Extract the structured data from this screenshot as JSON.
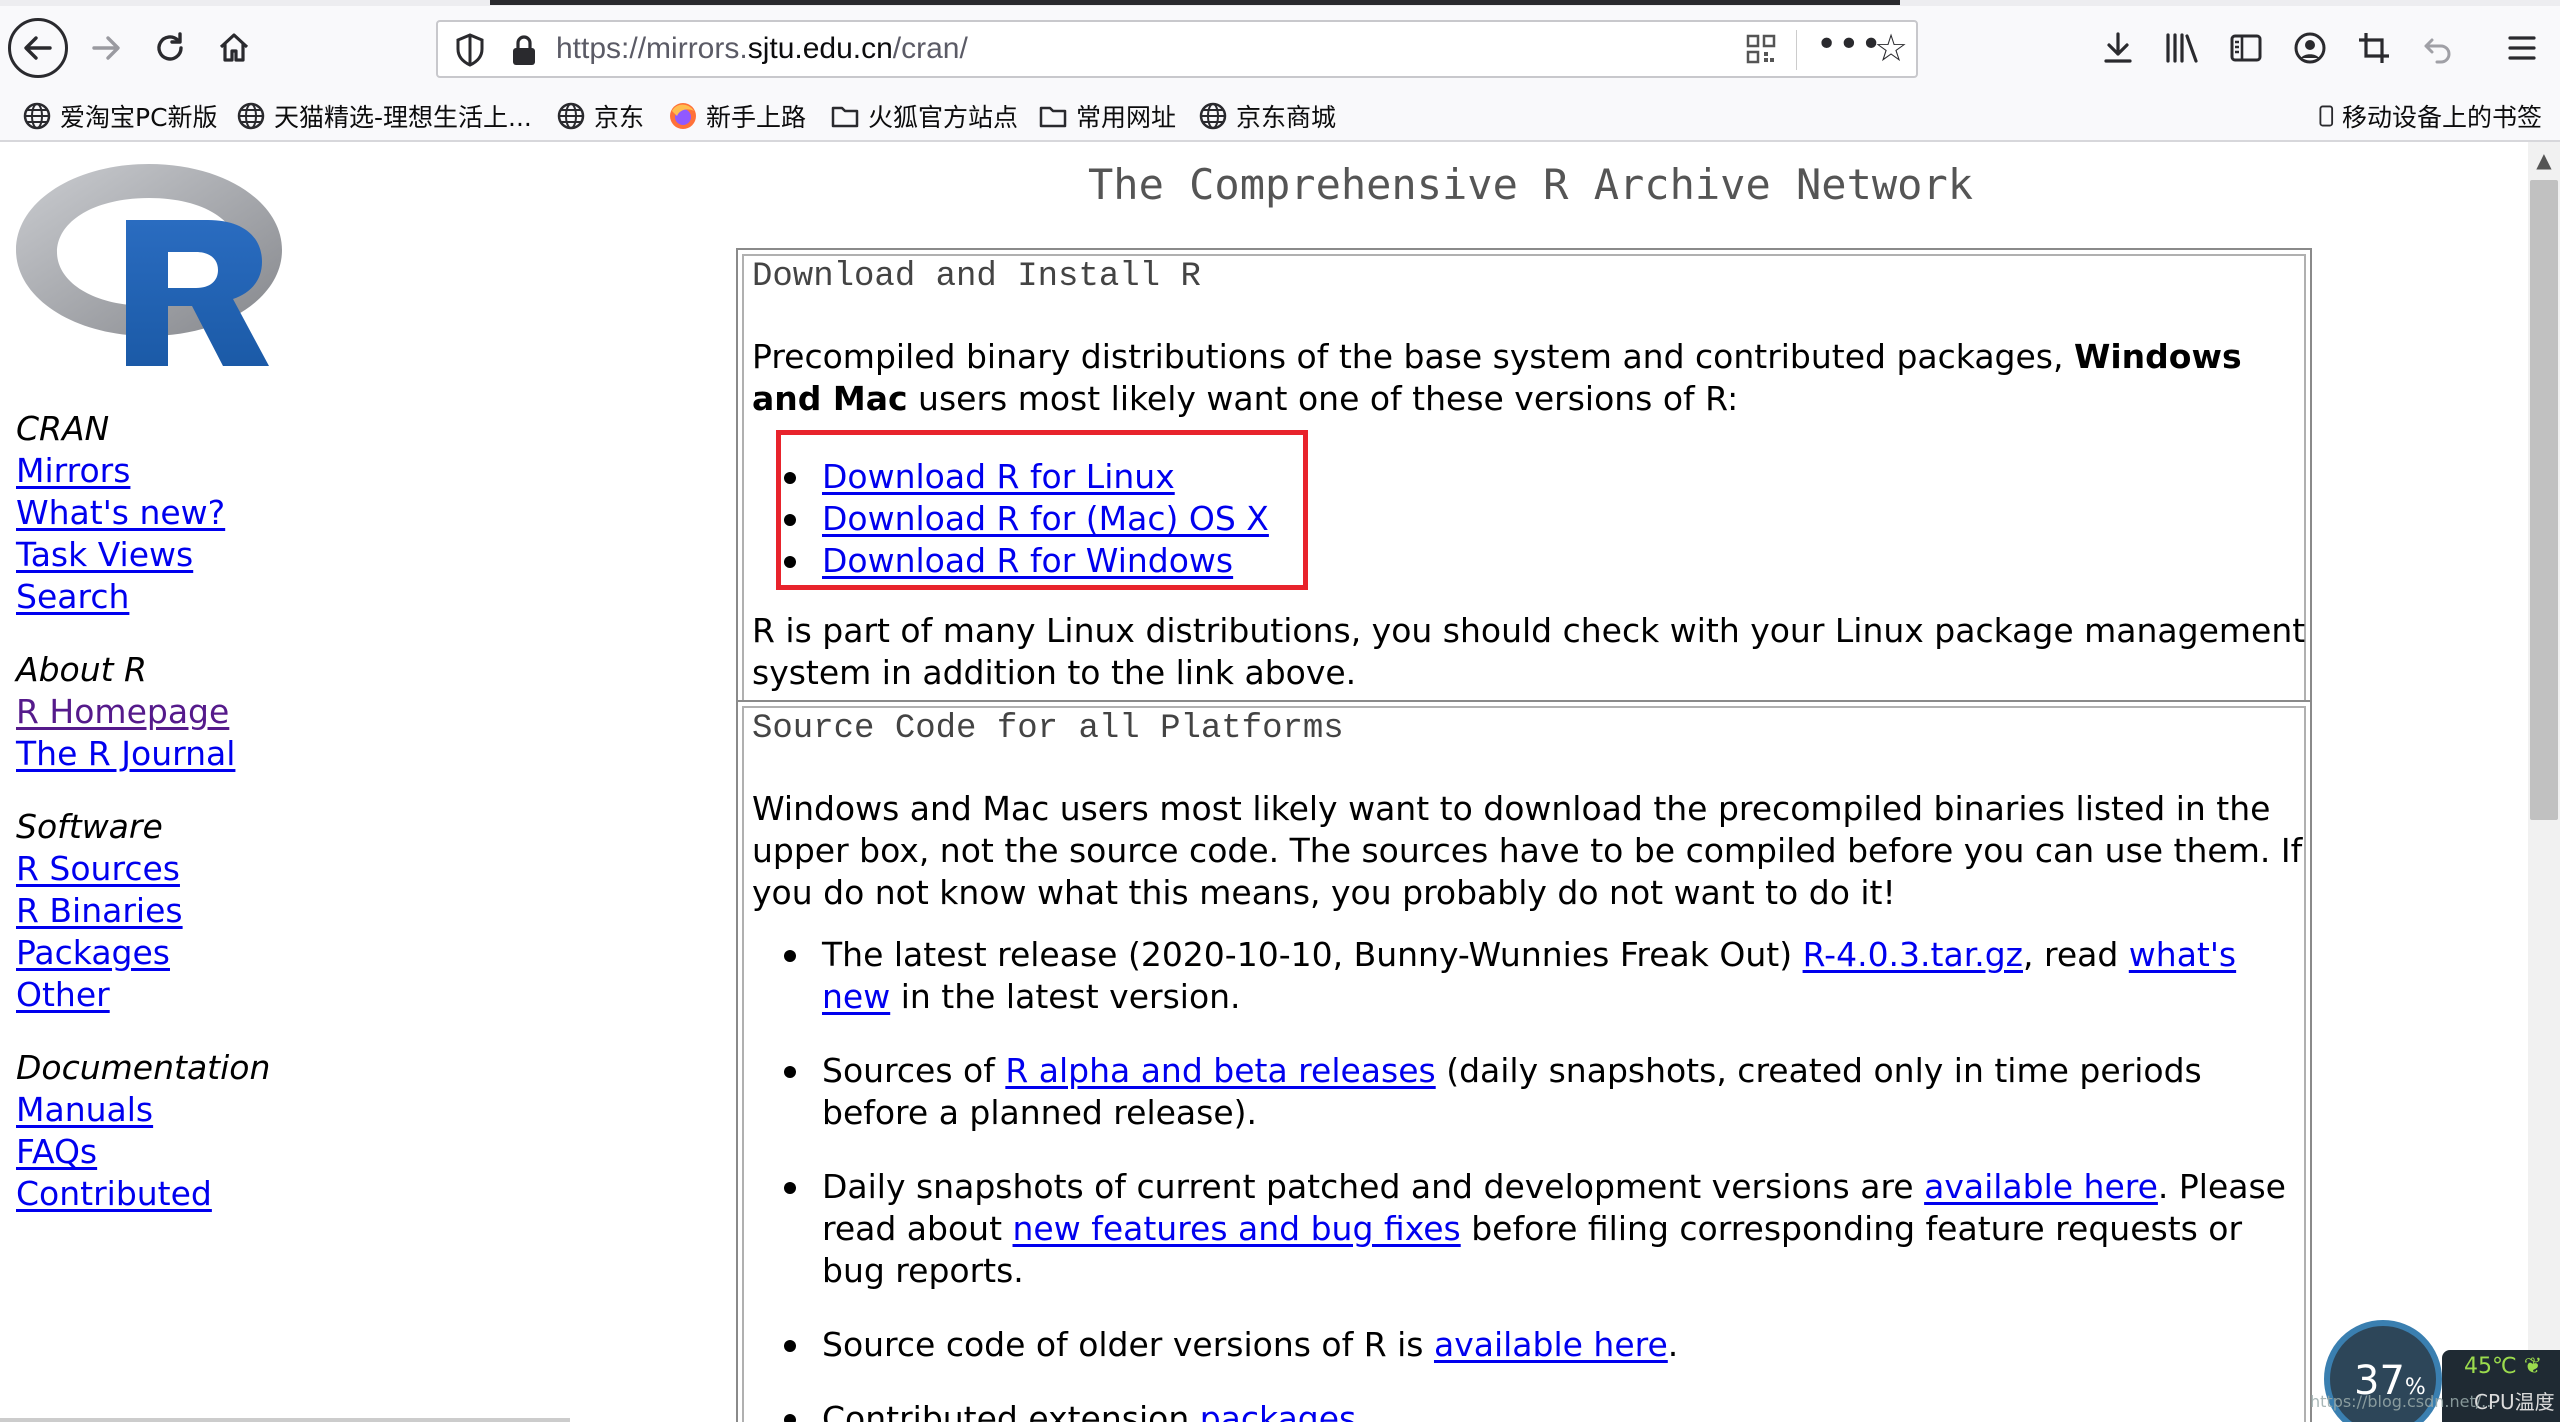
{
  "browser": {
    "url": {
      "prefix": "https://mirrors.",
      "domain": "sjtu.edu.cn",
      "path": "/cran/"
    },
    "bookmarks": [
      {
        "label": "爱淘宝PC新版",
        "icon": "globe-icon"
      },
      {
        "label": "天猫精选-理想生活上...",
        "icon": "globe-icon"
      },
      {
        "label": "京东",
        "icon": "globe-icon"
      },
      {
        "label": "新手上路",
        "icon": "firefox-icon"
      },
      {
        "label": "火狐官方站点",
        "icon": "folder-icon"
      },
      {
        "label": "常用网址",
        "icon": "folder-icon"
      },
      {
        "label": "京东商城",
        "icon": "globe-icon"
      }
    ],
    "mobile_bookmarks": "移动设备上的书签"
  },
  "page": {
    "title": "The Comprehensive R Archive Network",
    "sidebar": {
      "groups": [
        {
          "heading": "CRAN",
          "links": [
            "Mirrors",
            "What's new?",
            "Task Views",
            "Search"
          ]
        },
        {
          "heading": "About R",
          "links": [
            "R Homepage",
            "The R Journal"
          ]
        },
        {
          "heading": "Software",
          "links": [
            "R Sources",
            "R Binaries",
            "Packages",
            "Other"
          ]
        },
        {
          "heading": "Documentation",
          "links": [
            "Manuals",
            "FAQs",
            "Contributed"
          ]
        }
      ]
    },
    "download_box": {
      "heading": "Download and Install R",
      "intro_pre": "Precompiled binary distributions of the base system and contributed packages, ",
      "intro_bold": "Windows and Mac",
      "intro_post": " users most likely want one of these versions of R:",
      "links": [
        "Download R for Linux",
        "Download R for (Mac) OS X",
        "Download R for Windows"
      ],
      "note": "R is part of many Linux distributions, you should check with your Linux package management system in addition to the link above."
    },
    "source_box": {
      "heading": "Source Code for all Platforms",
      "intro": "Windows and Mac users most likely want to download the precompiled binaries listed in the upper box, not the source code. The sources have to be compiled before you can use them. If you do not know what this means, you probably do not want to do it!",
      "items": [
        {
          "t1": "The latest release (2020-10-10, Bunny-Wunnies Freak Out) ",
          "l1": "R-4.0.3.tar.gz",
          "t2": ", read ",
          "l2": "what's new",
          "t3": " in the latest version."
        },
        {
          "t1": "Sources of ",
          "l1": "R alpha and beta releases",
          "t2": " (daily snapshots, created only in time periods before a planned release).",
          "l2": "",
          "t3": ""
        },
        {
          "t1": "Daily snapshots of current patched and development versions are ",
          "l1": "available here",
          "t2": ". Please read about ",
          "l2": "new features and bug fixes",
          "t3": " before filing corresponding feature requests or bug reports."
        },
        {
          "t1": "Source code of older versions of R is ",
          "l1": "available here",
          "t2": ".",
          "l2": "",
          "t3": ""
        },
        {
          "t1": "Contributed extension ",
          "l1": "packages",
          "t2": "",
          "l2": "",
          "t3": ""
        }
      ]
    }
  },
  "widget": {
    "cpu_percent": "37",
    "percent_sign": "%",
    "temperature": "45℃",
    "label": "CPU温度"
  },
  "watermark": "https://blog.csdn.net/..."
}
